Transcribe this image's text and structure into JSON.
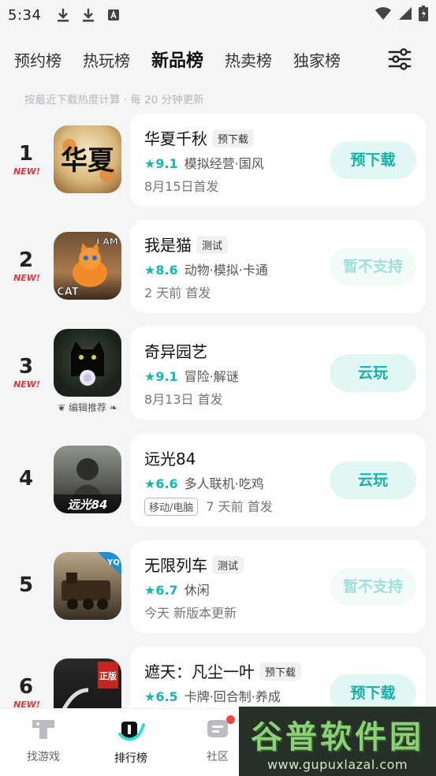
{
  "status_bar": {
    "time": "5:34"
  },
  "tabs": [
    {
      "label": "预约榜"
    },
    {
      "label": "热玩榜"
    },
    {
      "label": "新品榜"
    },
    {
      "label": "热卖榜"
    },
    {
      "label": "独家榜"
    }
  ],
  "hint": "按最近下载热度计算 · 每 20 分钟更新",
  "rows": [
    {
      "rank": "1",
      "new": "NEW!",
      "name": "华夏千秋",
      "badge": "预下载",
      "score": "★9.1",
      "tags": "模拟经营·国风",
      "sub": "8月15日首发",
      "action": "预下载",
      "icon_text": "华夏"
    },
    {
      "rank": "2",
      "new": "NEW!",
      "name": "我是猫",
      "badge": "测试",
      "score": "★8.6",
      "tags": "动物·模拟·卡通",
      "sub": "2 天前 首发",
      "action": "暂不支持",
      "icon_text": "I AM CAT"
    },
    {
      "rank": "3",
      "new": "NEW!",
      "name": "奇异园艺",
      "badge": "",
      "score": "★9.1",
      "tags": "冒险·解谜",
      "sub": "8月13日 首发",
      "action": "云玩",
      "editor_pick": "编辑推荐"
    },
    {
      "rank": "4",
      "new": "",
      "name": "远光84",
      "badge": "",
      "score": "★6.6",
      "tags": "多人联机·吃鸡",
      "platform": "移动/电脑",
      "sub": "7 天前 首发",
      "action": "云玩",
      "icon_text": "远光84"
    },
    {
      "rank": "5",
      "new": "",
      "name": "无限列车",
      "badge": "测试",
      "score": "★6.7",
      "tags": "休闲",
      "sub": "今天 新版本更新",
      "action": "暂不支持",
      "icon_text": "YQ"
    },
    {
      "rank": "6",
      "new": "NEW!",
      "name": "遮天：凡尘一叶",
      "badge": "预下载",
      "score": "★6.5",
      "tags": "卡牌·回合制·养成",
      "sub": "",
      "action": "预下载",
      "icon_text": "正版"
    }
  ],
  "bottom_nav": [
    {
      "label": "找游戏"
    },
    {
      "label": "排行榜"
    },
    {
      "label": "社区"
    }
  ],
  "watermark": {
    "title": "谷普软件园",
    "url": "www.gupuxlazal.com"
  }
}
